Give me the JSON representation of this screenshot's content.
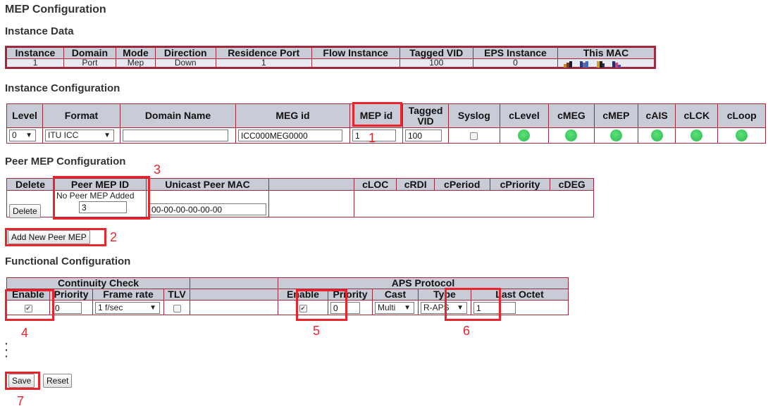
{
  "page": {
    "title": "MEP Configuration",
    "instance_data_heading": "Instance Data",
    "instance_config_heading": "Instance Configuration",
    "peer_mep_heading": "Peer MEP Configuration",
    "functional_heading": "Functional Configuration"
  },
  "instance_data": {
    "headers": [
      "Instance",
      "Domain",
      "Mode",
      "Direction",
      "Residence Port",
      "Flow Instance",
      "Tagged VID",
      "EPS Instance",
      "This MAC"
    ],
    "row": {
      "instance": "1",
      "domain": "Port",
      "mode": "Mep",
      "direction": "Down",
      "residence_port": "1",
      "flow_instance": "",
      "tagged_vid": "100",
      "eps_instance": "0",
      "this_mac_icon": "mac-address-icon"
    }
  },
  "instance_config": {
    "headers": {
      "level": "Level",
      "format": "Format",
      "domain_name": "Domain Name",
      "meg_id": "MEG id",
      "mep_id": "MEP id",
      "tagged_vid": "Tagged VID",
      "syslog": "Syslog",
      "clevel": "cLevel",
      "cmeg": "cMEG",
      "cmep": "cMEP",
      "cais": "cAIS",
      "clck": "cLCK",
      "cloop": "cLoop"
    },
    "level": "0",
    "format": "ITU ICC",
    "domain_name": "",
    "meg_id": "ICC000MEG0000",
    "mep_id": "1",
    "tagged_vid": "100",
    "led_color": "#2bbb50"
  },
  "peer_mep": {
    "headers": {
      "delete": "Delete",
      "peer_mep_id": "Peer MEP ID",
      "unicast_peer_mac": "Unicast Peer MAC",
      "cloc": "cLOC",
      "crdi": "cRDI",
      "cperiod": "cPeriod",
      "cpriority": "cPriority",
      "cdeg": "cDEG"
    },
    "no_peer_text": "No Peer MEP Added",
    "delete_label": "Delete",
    "peer_id_value": "3",
    "mac_value": "00-00-00-00-00-00",
    "add_button": "Add New Peer MEP"
  },
  "functional": {
    "cc_group": "Continuity Check",
    "aps_group": "APS Protocol",
    "cc_headers": {
      "enable": "Enable",
      "priority": "Priority",
      "frame_rate": "Frame rate",
      "tlv": "TLV"
    },
    "aps_headers": {
      "enable": "Enable",
      "priority": "Priority",
      "cast": "Cast",
      "type": "Type",
      "last_octet": "Last Octet"
    },
    "cc_priority": "0",
    "frame_rate": "1 f/sec",
    "aps_priority": "0",
    "cast": "Multi",
    "type": "R-APS",
    "last_octet": "1"
  },
  "buttons": {
    "save": "Save",
    "reset": "Reset"
  },
  "annotations": [
    "1",
    "2",
    "3",
    "4",
    "5",
    "6",
    "7"
  ],
  "colors": {
    "border": "#9c2a3c",
    "header_bg": "#c9ccd6",
    "highlight": "#e8242c",
    "led": "#2bbb50"
  }
}
